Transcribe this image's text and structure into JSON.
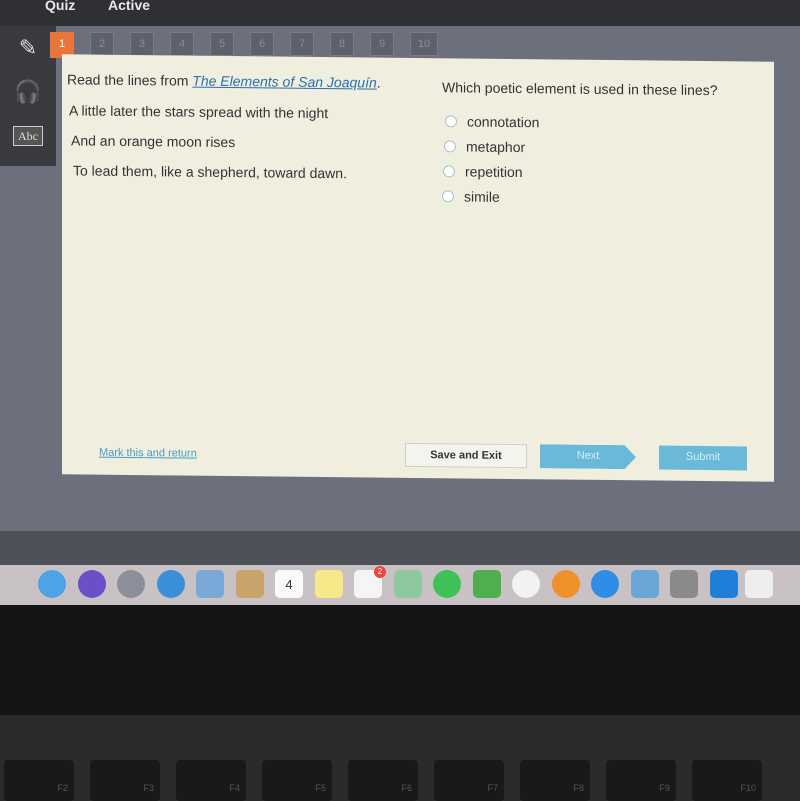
{
  "topbar": {
    "title": "Quiz",
    "status": "Active"
  },
  "tools": [
    {
      "icon": "pencil-icon"
    },
    {
      "icon": "headphones-icon"
    },
    {
      "icon": "dictionary-icon",
      "label": "Abc"
    }
  ],
  "question_tabs": [
    "1",
    "2",
    "3",
    "4",
    "5",
    "6",
    "7",
    "8",
    "9",
    "10"
  ],
  "active_tab": "1",
  "passage": {
    "intro_prefix": "Read the lines from ",
    "intro_title": "The Elements of San Joaquín",
    "intro_suffix": ".",
    "lines": [
      "A little later the stars spread with the night",
      "And an orange moon rises",
      "To lead them, like a shepherd, toward dawn."
    ]
  },
  "question": {
    "prompt": "Which poetic element is used in these lines?",
    "options": [
      "connotation",
      "metaphor",
      "repetition",
      "simile"
    ],
    "selected": null
  },
  "footer": {
    "mark": "Mark this and return",
    "save": "Save and Exit",
    "next": "Next",
    "submit": "Submit"
  },
  "colors": {
    "active_tab": "#e8763a",
    "button": "#6bb9d8",
    "card": "#efeedf"
  },
  "dock": [
    "finder",
    "siri",
    "launchpad",
    "safari",
    "preview",
    "contacts",
    "calendar",
    "notes",
    "reminders",
    "maps",
    "facetime",
    "numbers",
    "itunes",
    "ibooks",
    "app-store",
    "keynote",
    "system-preferences",
    "teamviewer",
    "trash"
  ],
  "calendar_day": "4",
  "reminders_badge": "2",
  "keys": [
    "F2",
    "F3",
    "F4",
    "F5",
    "F6",
    "F7",
    "F8",
    "F9",
    "F10"
  ]
}
